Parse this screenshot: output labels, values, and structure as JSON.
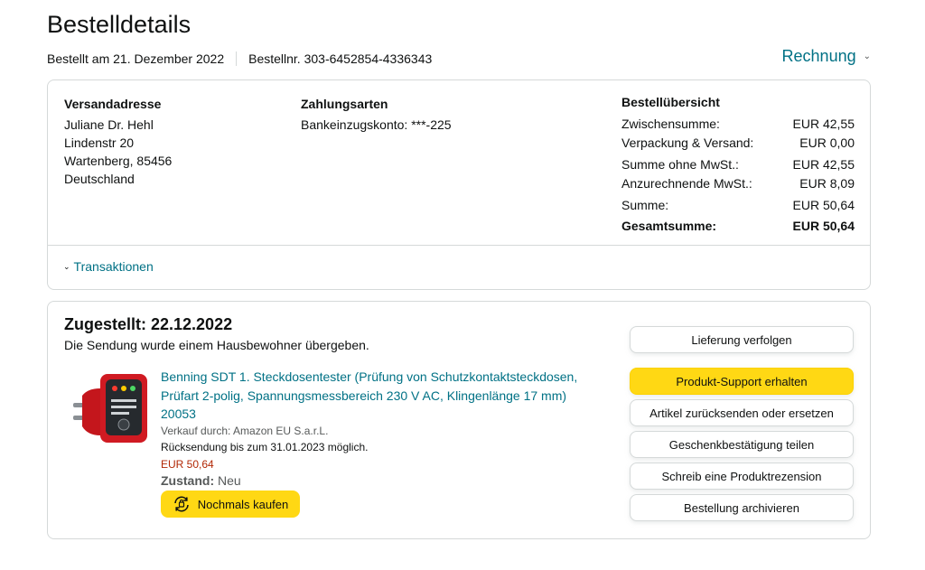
{
  "page": {
    "title": "Bestelldetails",
    "order_date": "Bestellt am 21. Dezember 2022",
    "order_number": "Bestellnr. 303-6452854-4336343",
    "invoice_label": "Rechnung"
  },
  "shipping_address": {
    "title": "Versandadresse",
    "lines": [
      "Juliane Dr. Hehl",
      "Lindenstr 20",
      "Wartenberg, 85456",
      "Deutschland"
    ]
  },
  "payment": {
    "title": "Zahlungsarten",
    "method": "Bankeinzugskonto: ***-225"
  },
  "summary": {
    "title": "Bestellübersicht",
    "rows": [
      {
        "label": "Zwischensumme:",
        "value": "EUR 42,55"
      },
      {
        "label": "Verpackung & Versand:",
        "value": "EUR 0,00"
      },
      {
        "label": "Summe ohne MwSt.:",
        "value": "EUR 42,55"
      },
      {
        "label": "Anzurechnende MwSt.:",
        "value": "EUR 8,09"
      },
      {
        "label": "Summe:",
        "value": "EUR 50,64"
      },
      {
        "label": "Gesamtsumme:",
        "value": "EUR 50,64"
      }
    ]
  },
  "transactions": {
    "label": "Transaktionen"
  },
  "shipment": {
    "status_title": "Zugestellt: 22.12.2022",
    "status_sub": "Die Sendung wurde einem Hausbewohner übergeben.",
    "product": {
      "title": "Benning SDT 1. Steckdosentester (Prüfung von Schutzkontaktsteckdosen, Prüfart 2-polig, Spannungsmessbereich 230 V AC, Klingenlänge 17 mm) 20053",
      "seller": "Verkauf durch: Amazon EU S.a.r.L.",
      "return_window": "Rücksendung bis zum 31.01.2023 möglich.",
      "price": "EUR 50,64",
      "condition_label": "Zustand:",
      "condition_value": "Neu",
      "buy_again_label": "Nochmals kaufen"
    },
    "actions": [
      "Lieferung verfolgen",
      "Produkt-Support erhalten",
      "Artikel zurücksenden oder ersetzen",
      "Geschenkbestätigung teilen",
      "Schreib eine Produktrezension",
      "Bestellung archivieren"
    ]
  },
  "colors": {
    "link": "#007185",
    "primary_button": "#ffd814",
    "price": "#b12704",
    "border": "#d5d9d9"
  },
  "icons": [
    "chevron-down-icon",
    "buy-again-icon"
  ]
}
